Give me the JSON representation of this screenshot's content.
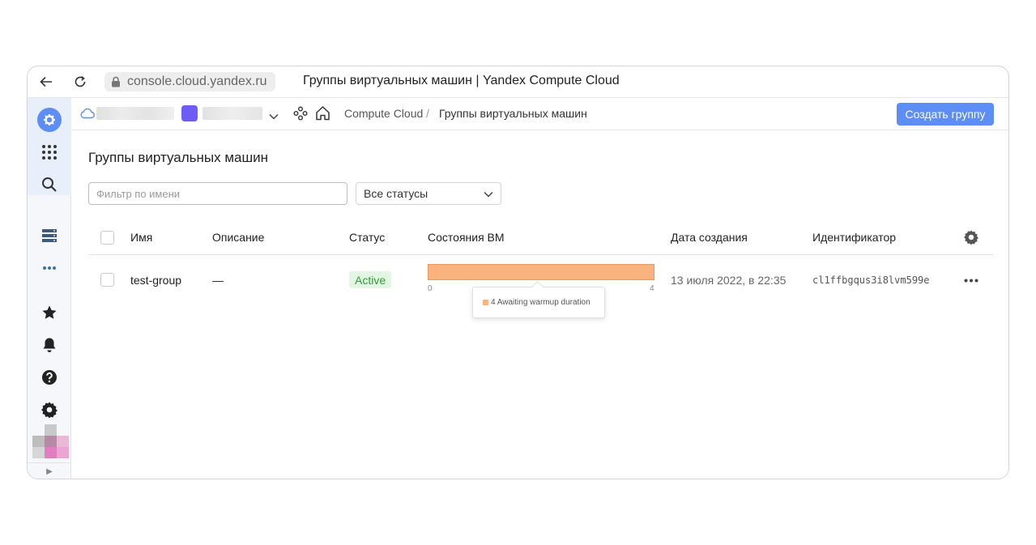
{
  "browser": {
    "url": "console.cloud.yandex.ru",
    "tab_title": "Группы виртуальных машин | Yandex Compute Cloud"
  },
  "breadcrumb": {
    "service": "Compute Cloud",
    "separator": "/",
    "current": "Группы виртуальных машин"
  },
  "header": {
    "create_button": "Создать группу"
  },
  "page": {
    "title": "Группы виртуальных машин",
    "filter_placeholder": "Фильтр по имени",
    "status_select": "Все статусы"
  },
  "table": {
    "columns": {
      "name": "Имя",
      "description": "Описание",
      "status": "Статус",
      "vm_states": "Состояния ВМ",
      "created": "Дата создания",
      "id": "Идентификатор"
    },
    "rows": [
      {
        "name": "test-group",
        "description": "—",
        "status": "Active",
        "vm_states": {
          "min_label": "0",
          "max_label": "4",
          "tooltip": "4 Awaiting warmup duration",
          "bar_color": "#f9b37e"
        },
        "created": "13 июля 2022, в 22:35",
        "id": "cl1ffbgqus3i8lvm599e"
      }
    ]
  },
  "colors": {
    "accent": "#5c8ef5",
    "folder": "#6e5cf6",
    "active_bg": "#e3f6e3",
    "active_text": "#2e9e3b"
  }
}
